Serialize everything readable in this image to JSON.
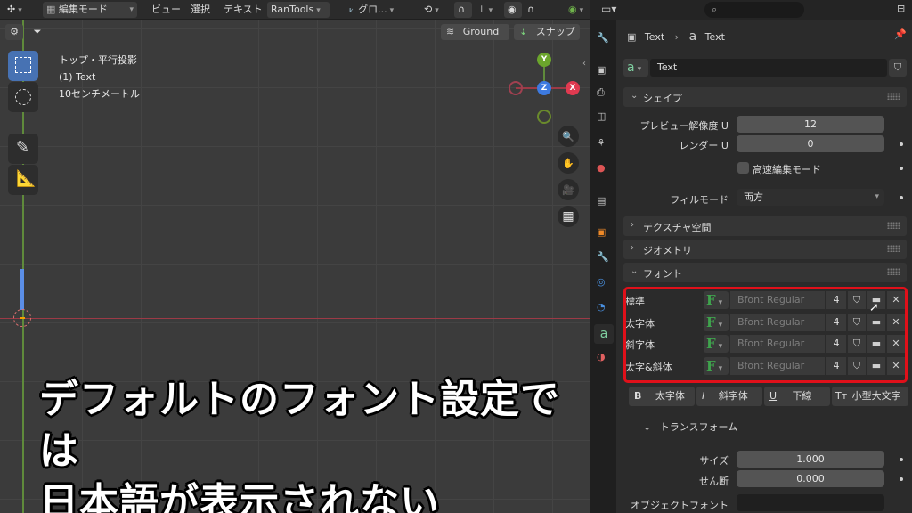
{
  "header": {
    "mode": "編集モード",
    "menus": [
      "ビュー",
      "選択",
      "テキスト"
    ],
    "addon": "RanTools",
    "transform_orientation": "グロ..."
  },
  "viewport": {
    "ground_btn": "Ground",
    "snap_btn": "スナップ",
    "overlay_lines": [
      "トップ・平行投影",
      "(1) Text",
      "10センチメートル"
    ],
    "axes": {
      "y": "Y",
      "z": "Z",
      "x": "X"
    }
  },
  "caption": {
    "line1": "デフォルトのフォント設定では",
    "line2": "日本語が表示されない"
  },
  "properties": {
    "breadcrumb": {
      "object": "Text",
      "data": "Text"
    },
    "datablock_name": "Text",
    "panels": {
      "shape": "シェイプ",
      "texture_space": "テクスチャ空間",
      "geometry": "ジオメトリ",
      "font": "フォント",
      "transform": "トランスフォーム"
    },
    "shape": {
      "preview_res_label": "プレビュー解像度 U",
      "preview_res_value": "12",
      "render_label": "レンダー U",
      "render_value": "0",
      "fast_edit_label": "高速編集モード",
      "fill_mode_label": "フィルモード",
      "fill_mode_value": "両方"
    },
    "fonts": [
      {
        "label": "標準",
        "name": "Bfont Regular",
        "users": "4"
      },
      {
        "label": "太字体",
        "name": "Bfont Regular",
        "users": "4"
      },
      {
        "label": "斜字体",
        "name": "Bfont Regular",
        "users": "4"
      },
      {
        "label": "太字&斜体",
        "name": "Bfont Regular",
        "users": "4"
      }
    ],
    "style_buttons": {
      "bold": "太字体",
      "italic": "斜字体",
      "underline": "下線",
      "smallcaps": "小型大文字"
    },
    "transform": {
      "size_label": "サイズ",
      "size_value": "1.000",
      "shear_label": "せん断",
      "shear_value": "0.000",
      "object_font_label": "オブジェクトフォント"
    }
  },
  "colors": {
    "accent": "#4772b3",
    "highlight_box": "#e0101a",
    "font_icon": "#3fa34d"
  }
}
